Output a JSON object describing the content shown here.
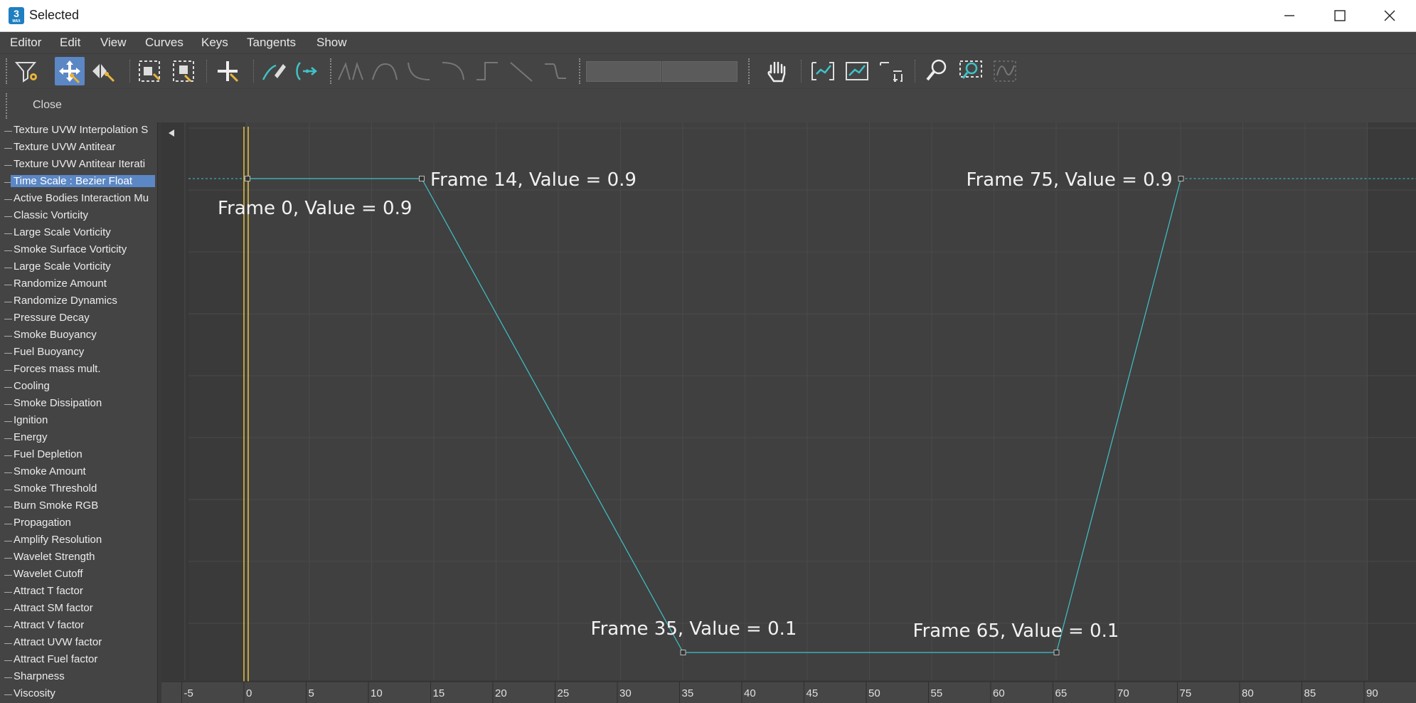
{
  "window": {
    "title": "Selected",
    "app_icon_text": "3",
    "app_icon_sub": "MAX"
  },
  "menu": [
    "Editor",
    "Edit",
    "View",
    "Curves",
    "Keys",
    "Tangents",
    "Show"
  ],
  "toolbar": {
    "icons": [
      "filter-icon",
      "move-keys-icon",
      "slide-keys-icon",
      "scale-keys-icon",
      "scale-values-icon",
      "add-keys-icon",
      "draw-curves-icon",
      "reduce-keys-icon",
      "tangent-auto-icon",
      "tangent-custom-icon",
      "tangent-fast-icon",
      "tangent-slow-icon",
      "tangent-step-icon",
      "tangent-linear-icon",
      "tangent-smooth-icon",
      "pan-icon",
      "frame-horizontal-icon",
      "frame-values-icon",
      "frame-selection-icon",
      "zoom-icon",
      "zoom-region-icon",
      "isolate-curve-icon"
    ]
  },
  "secondary_toolbar": {
    "close_label": "Close"
  },
  "tree": {
    "items": [
      "Texture UVW Interpolation S",
      "Texture UVW Antitear",
      "Texture UVW Antitear Iterati",
      "Time Scale : Bezier Float",
      "Active Bodies Interaction Mu",
      "Classic Vorticity",
      "Large Scale Vorticity",
      "Smoke Surface Vorticity",
      "Large Scale Vorticity",
      "Randomize Amount",
      "Randomize Dynamics",
      "Pressure Decay",
      "Smoke Buoyancy",
      "Fuel Buoyancy",
      "Forces mass mult.",
      "Cooling",
      "Smoke Dissipation",
      "Ignition",
      "Energy",
      "Fuel Depletion",
      "Smoke Amount",
      "Smoke Threshold",
      "Burn Smoke RGB",
      "Propagation",
      "Amplify Resolution",
      "Wavelet Strength",
      "Wavelet Cutoff",
      "Attract T factor",
      "Attract SM factor",
      "Attract V factor",
      "Attract UVW factor",
      "Attract Fuel factor",
      "Sharpness",
      "Viscosity"
    ],
    "selected_index": 3
  },
  "graph": {
    "current_frame": 0,
    "range": [
      0,
      90
    ],
    "key_labels": [
      "Frame 0, Value = 0.9",
      "Frame 14, Value = 0.9",
      "Frame 35, Value = 0.1",
      "Frame 65, Value = 0.1",
      "Frame 75, Value = 0.9"
    ],
    "keys": [
      {
        "frame": 0,
        "value": 0.9
      },
      {
        "frame": 14,
        "value": 0.9
      },
      {
        "frame": 35,
        "value": 0.1
      },
      {
        "frame": 65,
        "value": 0.1
      },
      {
        "frame": 75,
        "value": 0.9
      }
    ],
    "ruler_ticks": [
      "-5",
      "0",
      "5",
      "10",
      "15",
      "20",
      "25",
      "30",
      "35",
      "40",
      "45",
      "50",
      "55",
      "60",
      "65",
      "70",
      "75",
      "80",
      "85",
      "90"
    ],
    "colors": {
      "curve": "#3fc3c8",
      "current_frame": "#e8c440",
      "selection": "#5b87c5"
    }
  }
}
